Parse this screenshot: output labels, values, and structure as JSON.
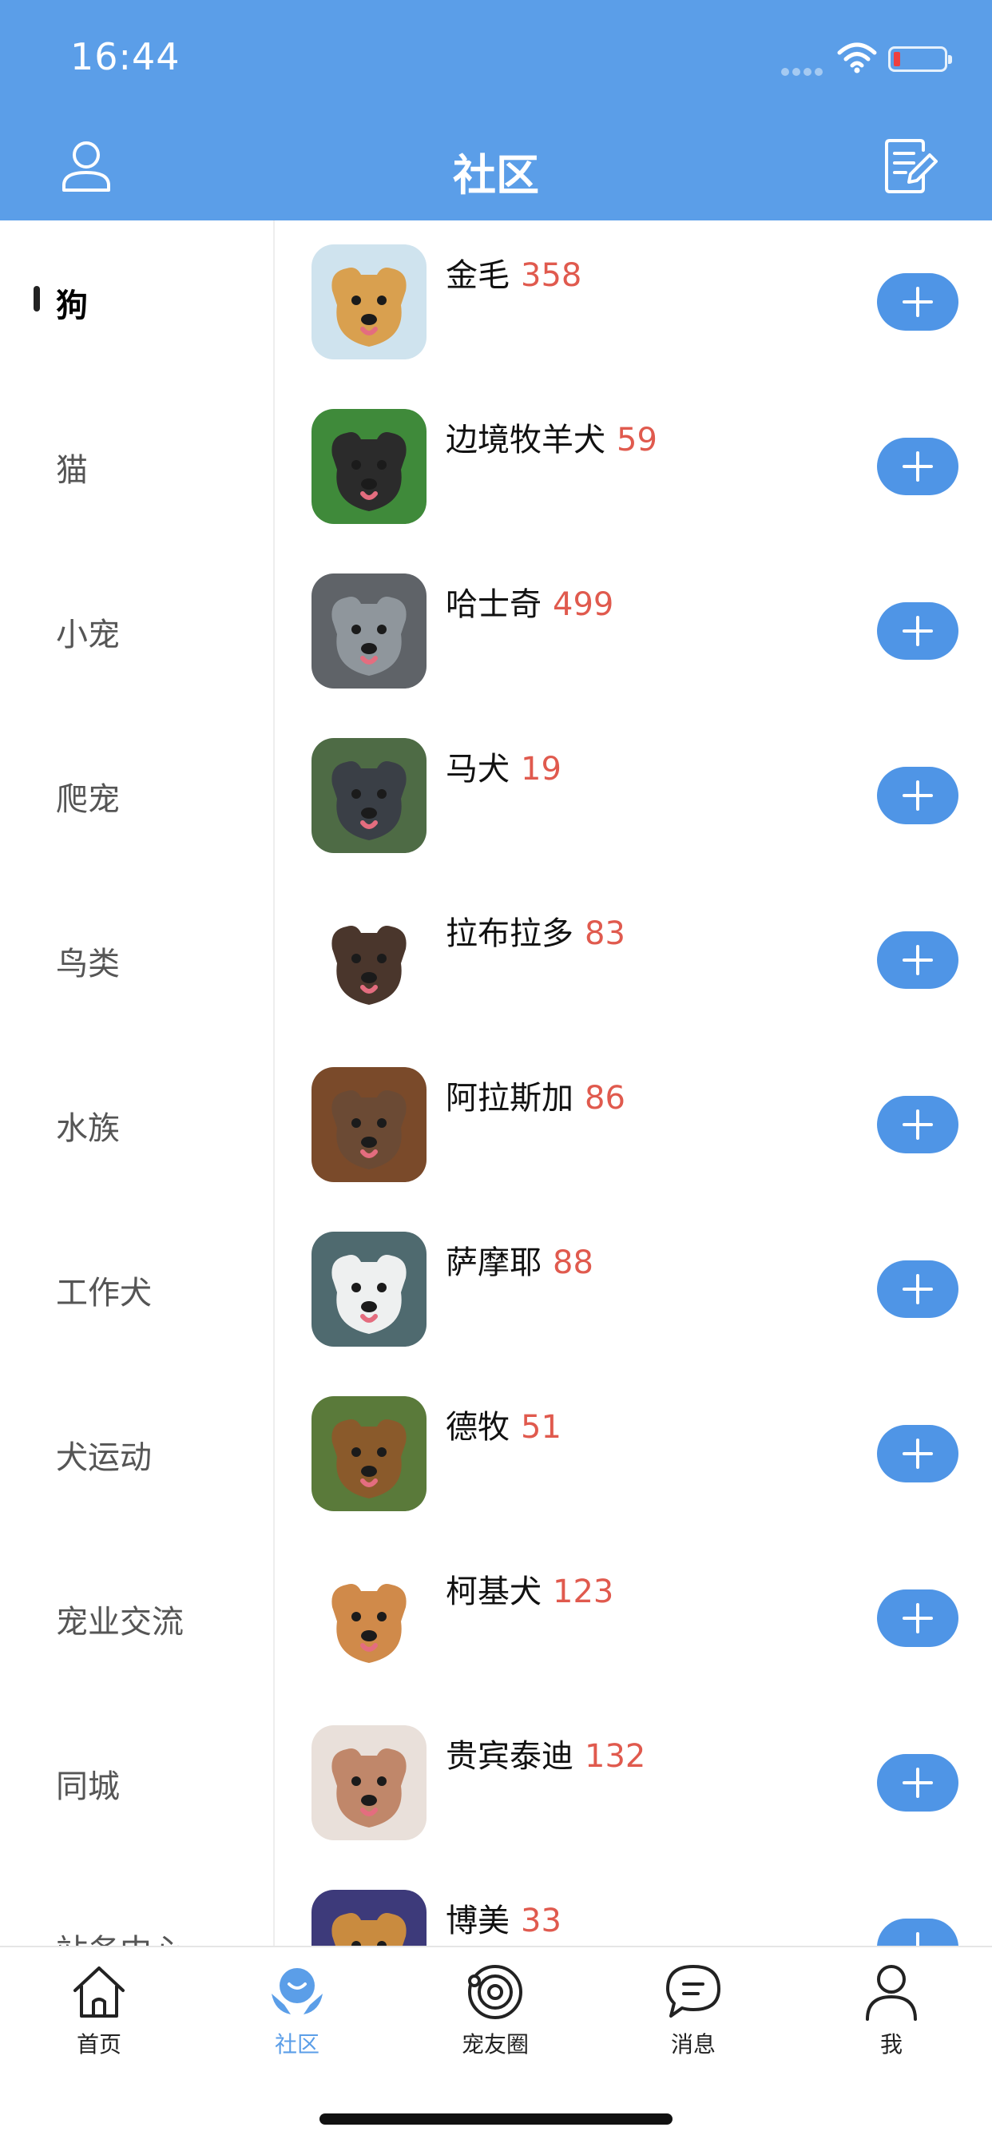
{
  "status_bar": {
    "time": "16:44"
  },
  "header": {
    "title": "社区"
  },
  "sidebar": {
    "items": [
      {
        "label": "狗",
        "active": true
      },
      {
        "label": "猫"
      },
      {
        "label": "小宠"
      },
      {
        "label": "爬宠"
      },
      {
        "label": "鸟类"
      },
      {
        "label": "水族"
      },
      {
        "label": "工作犬"
      },
      {
        "label": "犬运动"
      },
      {
        "label": "宠业交流"
      },
      {
        "label": "同城"
      },
      {
        "label": "站务中心"
      }
    ]
  },
  "breeds": [
    {
      "name": "金毛",
      "count": "358",
      "color": "#d9a04f"
    },
    {
      "name": "边境牧羊犬",
      "count": "59",
      "color": "#2b2b2b"
    },
    {
      "name": "哈士奇",
      "count": "499",
      "color": "#8f969c"
    },
    {
      "name": "马犬",
      "count": "19",
      "color": "#3a3f46"
    },
    {
      "name": "拉布拉多",
      "count": "83",
      "color": "#4a362c"
    },
    {
      "name": "阿拉斯加",
      "count": "86",
      "color": "#6b4a34"
    },
    {
      "name": "萨摩耶",
      "count": "88",
      "color": "#eef0f0"
    },
    {
      "name": "德牧",
      "count": "51",
      "color": "#8a5a2b"
    },
    {
      "name": "柯基犬",
      "count": "123",
      "color": "#d08a4a"
    },
    {
      "name": "贵宾泰迪",
      "count": "132",
      "color": "#c0876a"
    },
    {
      "name": "博美",
      "count": "33",
      "color": "#c98b3f"
    }
  ],
  "tabbar": {
    "items": [
      {
        "label": "首页",
        "icon": "home-icon"
      },
      {
        "label": "社区",
        "icon": "community-icon",
        "active": true
      },
      {
        "label": "宠友圈",
        "icon": "pet-circle-icon"
      },
      {
        "label": "消息",
        "icon": "message-icon"
      },
      {
        "label": "我",
        "icon": "profile-icon"
      }
    ]
  },
  "colors": {
    "accent": "#5b9ee8",
    "count": "#e05a4e",
    "add_button": "#4f95e6"
  }
}
